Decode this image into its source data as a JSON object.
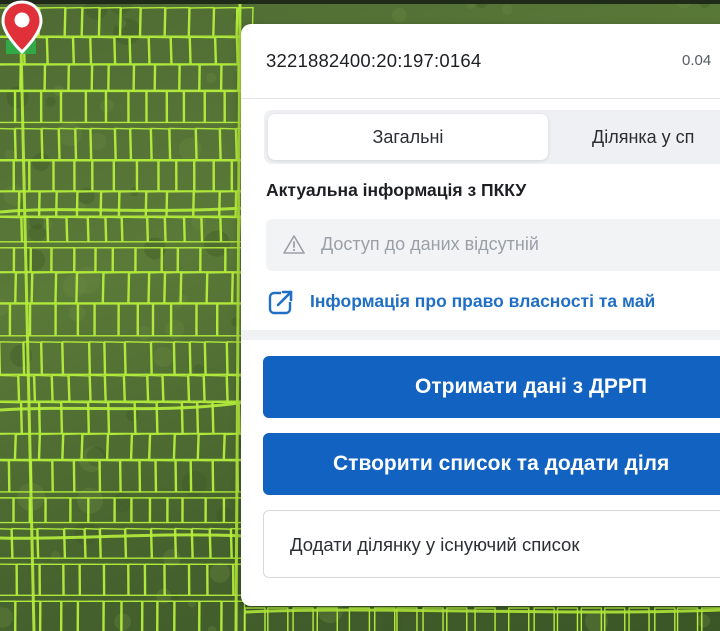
{
  "map": {
    "parcel_outline_color": "#b6ef3c",
    "marker_color": "#e0313a",
    "parcel_highlight_color": "#2eb34a"
  },
  "panel": {
    "cadastral_number": "3221882400:20:197:0164",
    "area": "0.04",
    "tabs": [
      {
        "label": "Загальні",
        "active": true
      },
      {
        "label": "Ділянка у сп",
        "active": false
      }
    ],
    "section_title": "Актуальна інформація з ПККУ",
    "notice_text": "Доступ до даних відсутній",
    "ownership_link": "Інформація про право власності та май",
    "buttons": {
      "get_drrp": "Отримати дані з ДРРП",
      "create_list": "Створити список та додати діля",
      "add_existing": "Додати ділянку у існуючий список"
    },
    "colors": {
      "primary": "#1262c1",
      "link": "#1f6fc4"
    }
  }
}
